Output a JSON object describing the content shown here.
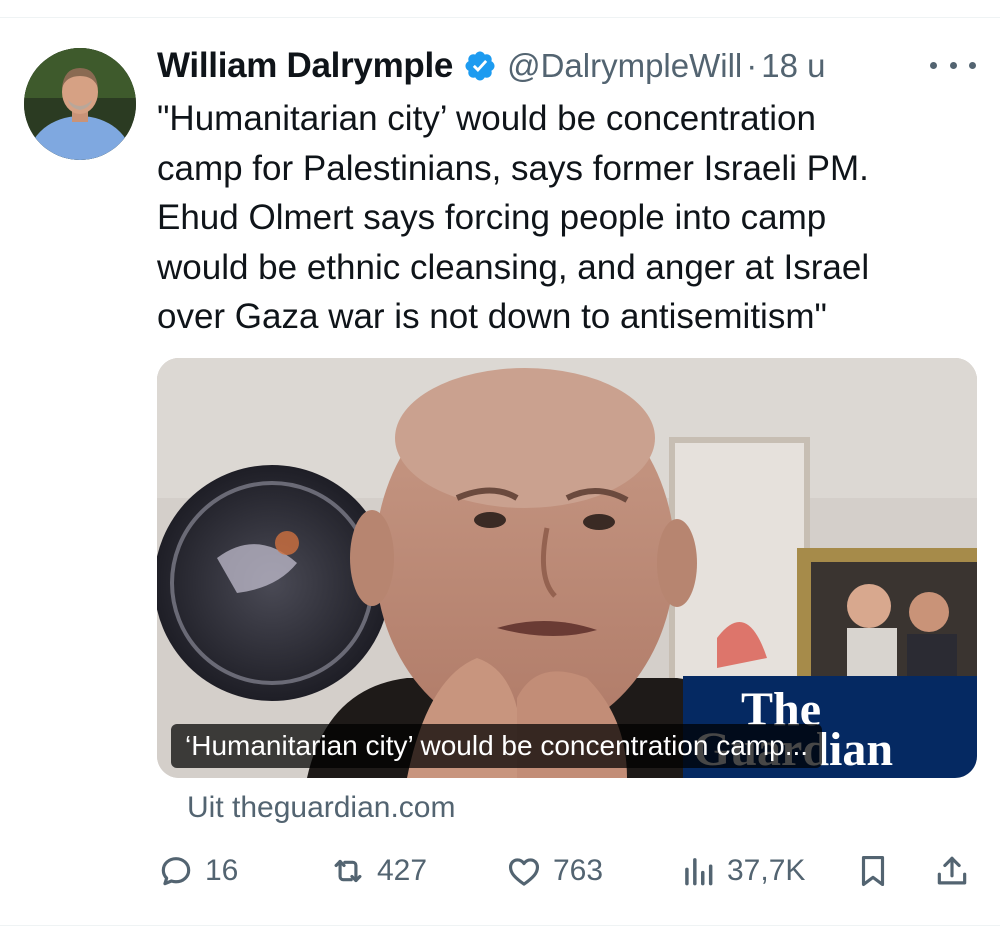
{
  "tweet": {
    "author_name": "William Dalrymple",
    "handle": "@DalrympleWill",
    "separator": "·",
    "time": "18 u",
    "text_lines": [
      "\"Humanitarian city’ would be concentration",
      "camp for Palestinians, says former Israeli PM.",
      "Ehud Olmert says forcing people into camp",
      "would be ethnic cleansing, and anger at Israel",
      "over Gaza war is not down to antisemitism\""
    ]
  },
  "card": {
    "caption": "‘Humanitarian city’ would be concentration camp...",
    "logo_line1": "The",
    "logo_line2": "Guardian",
    "source": "Uit theguardian.com"
  },
  "actions": {
    "replies": "16",
    "reposts": "427",
    "likes": "763",
    "views": "37,7K"
  },
  "icons": {
    "verified": "verified-badge-icon",
    "more": "more-horizontal-icon",
    "reply": "reply-bubble-icon",
    "repost": "repost-arrows-icon",
    "like": "heart-icon",
    "views": "bar-chart-icon",
    "bookmark": "bookmark-icon",
    "share": "share-upload-icon"
  },
  "colors": {
    "text_primary": "#0f1419",
    "text_secondary": "#536471",
    "verified_blue": "#1d9bf0",
    "guardian_blue": "#052962"
  }
}
